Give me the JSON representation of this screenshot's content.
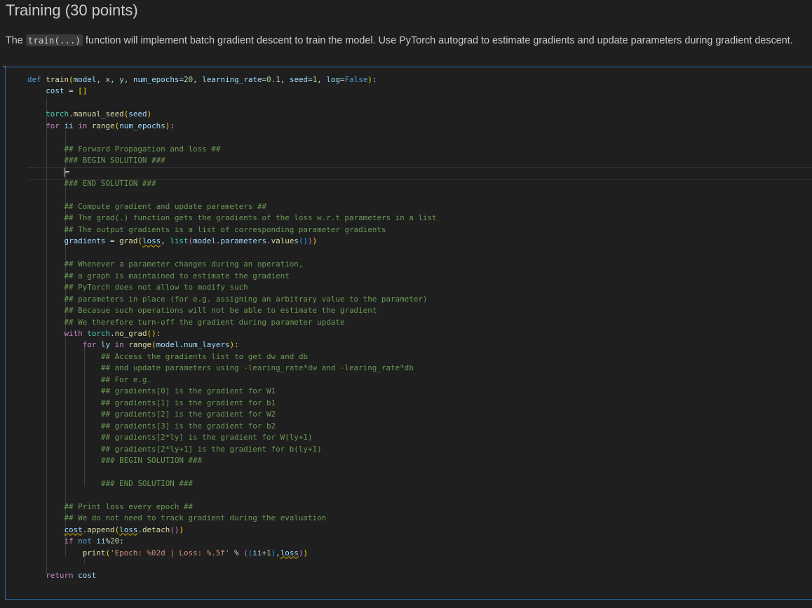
{
  "markdown": {
    "heading": "Training (30 points)",
    "para_before": "The ",
    "code_inline": "train(...)",
    "para_after": " function will implement batch gradient descent to train the model. Use PyTorch autograd to estimate gradients and update parameters during gradient descent."
  },
  "code": {
    "def_kw": "def",
    "fn_name": "train",
    "p_model": "model",
    "p_x": "x",
    "p_y": "y",
    "p_epochs": "num_epochs",
    "v_epochs": "20",
    "p_lr": "learning_rate",
    "v_lr": "0.1",
    "p_seed": "seed",
    "v_seed": "1",
    "p_log": "log",
    "v_log": "False",
    "cost_var": "cost",
    "torch1": "torch",
    "manual_seed": "manual_seed",
    "seed_arg": "seed",
    "for_kw": "for",
    "ii_var": "ii",
    "in_kw": "in",
    "range_fn": "range",
    "num_epochs_arg": "num_epochs",
    "c_fwd": "## Forward Propagation and loss ##",
    "c_begin1": "### BEGIN SOLUTION ###",
    "c_end1": "### END SOLUTION ###",
    "c_grad1": "## Compute gradient and update parameters ##",
    "c_grad2": "## The grad(.) function gets the gradients of the loss w.r.t parameters in a list",
    "c_grad3": "## The output gradients is a list of corresponding parameter gradients",
    "gradients_var": "gradients",
    "grad_fn": "grad",
    "loss_arg": "loss",
    "list_fn": "list",
    "model_ref": "model",
    "parameters_attr": "parameters",
    "values_fn": "values",
    "c_when1": "## Whenever a parameter changes during an operation,",
    "c_when2": "## a graph is maintained to estimate the gradient",
    "c_when3": "## PyTorch does not allow to modify such",
    "c_when4": "## parameters in place (for e.g. assigning an arbitrary value to the parameter)",
    "c_when5": "## Becasue such operations will not be able to estimate the gradient",
    "c_when6": "## We therefore turn-off the gradient during parameter update",
    "with_kw": "with",
    "torch2": "torch",
    "no_grad_fn": "no_grad",
    "for2_kw": "for",
    "ly_var": "ly",
    "in2_kw": "in",
    "range2_fn": "range",
    "model2": "model",
    "num_layers": "num_layers",
    "c_acc1": "## Access the gradients list to get dw and db",
    "c_acc2": "## and update parameters using -learing_rate*dw and -learing_rate*db",
    "c_acc3": "## For e.g.",
    "c_acc4": "## gradients[0] is the gradient for W1",
    "c_acc5": "## gradients[1] is the gradient for b1",
    "c_acc6": "## gradients[2] is the gradient for W2",
    "c_acc7": "## gradients[3] is the gradient for b2",
    "c_acc8": "## gradients[2*ly] is the gradient for W(ly+1)",
    "c_acc9": "## gradients[2*ly+1] is the gradient for b(ly+1)",
    "c_begin2": "### BEGIN SOLUTION ###",
    "c_end2": "### END SOLUTION ###",
    "c_print1": "## Print loss every epoch ##",
    "c_print2": "## We do not need to track gradient during the evaluation",
    "cost2": "cost",
    "append_fn": "append",
    "loss2": "loss",
    "detach_fn": "detach",
    "if_kw": "if",
    "not_kw": "not",
    "ii2": "ii",
    "mod_num": "20",
    "print_fn": "print",
    "fmt_str": "'Epoch: %02d | Loss: %.5f'",
    "ii3": "ii",
    "one": "1",
    "loss3": "loss",
    "return_kw": "return",
    "cost3": "cost"
  }
}
